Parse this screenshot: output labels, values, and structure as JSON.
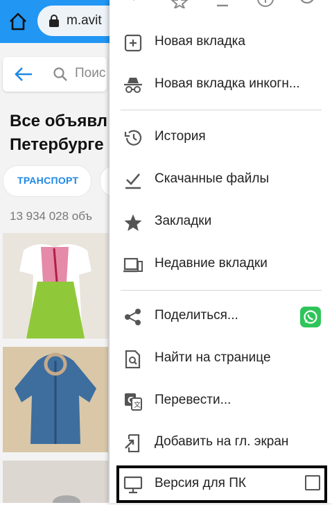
{
  "browser": {
    "url": "m.avit",
    "accent_color": "#2196f3"
  },
  "page": {
    "search_placeholder": "Поис",
    "title": "Все объявл\nПетербурге",
    "chip_label": "ТРАНСПОРТ",
    "results_count": "13 934 028 объ"
  },
  "menu": {
    "items": [
      {
        "label": "Новая вкладка",
        "icon": "new-tab-icon"
      },
      {
        "label": "Новая вкладка инкогн...",
        "icon": "incognito-icon"
      },
      {
        "label": "История",
        "icon": "history-icon"
      },
      {
        "label": "Скачанные файлы",
        "icon": "downloads-icon"
      },
      {
        "label": "Закладки",
        "icon": "bookmark-star-icon"
      },
      {
        "label": "Недавние вкладки",
        "icon": "recent-tabs-icon"
      },
      {
        "label": "Поделиться...",
        "icon": "share-icon"
      },
      {
        "label": "Найти на странице",
        "icon": "find-in-page-icon"
      },
      {
        "label": "Перевести...",
        "icon": "translate-icon"
      },
      {
        "label": "Добавить на гл. экран",
        "icon": "add-to-home-icon"
      },
      {
        "label": "Версия для ПК",
        "icon": "desktop-icon",
        "checked": false
      }
    ]
  }
}
